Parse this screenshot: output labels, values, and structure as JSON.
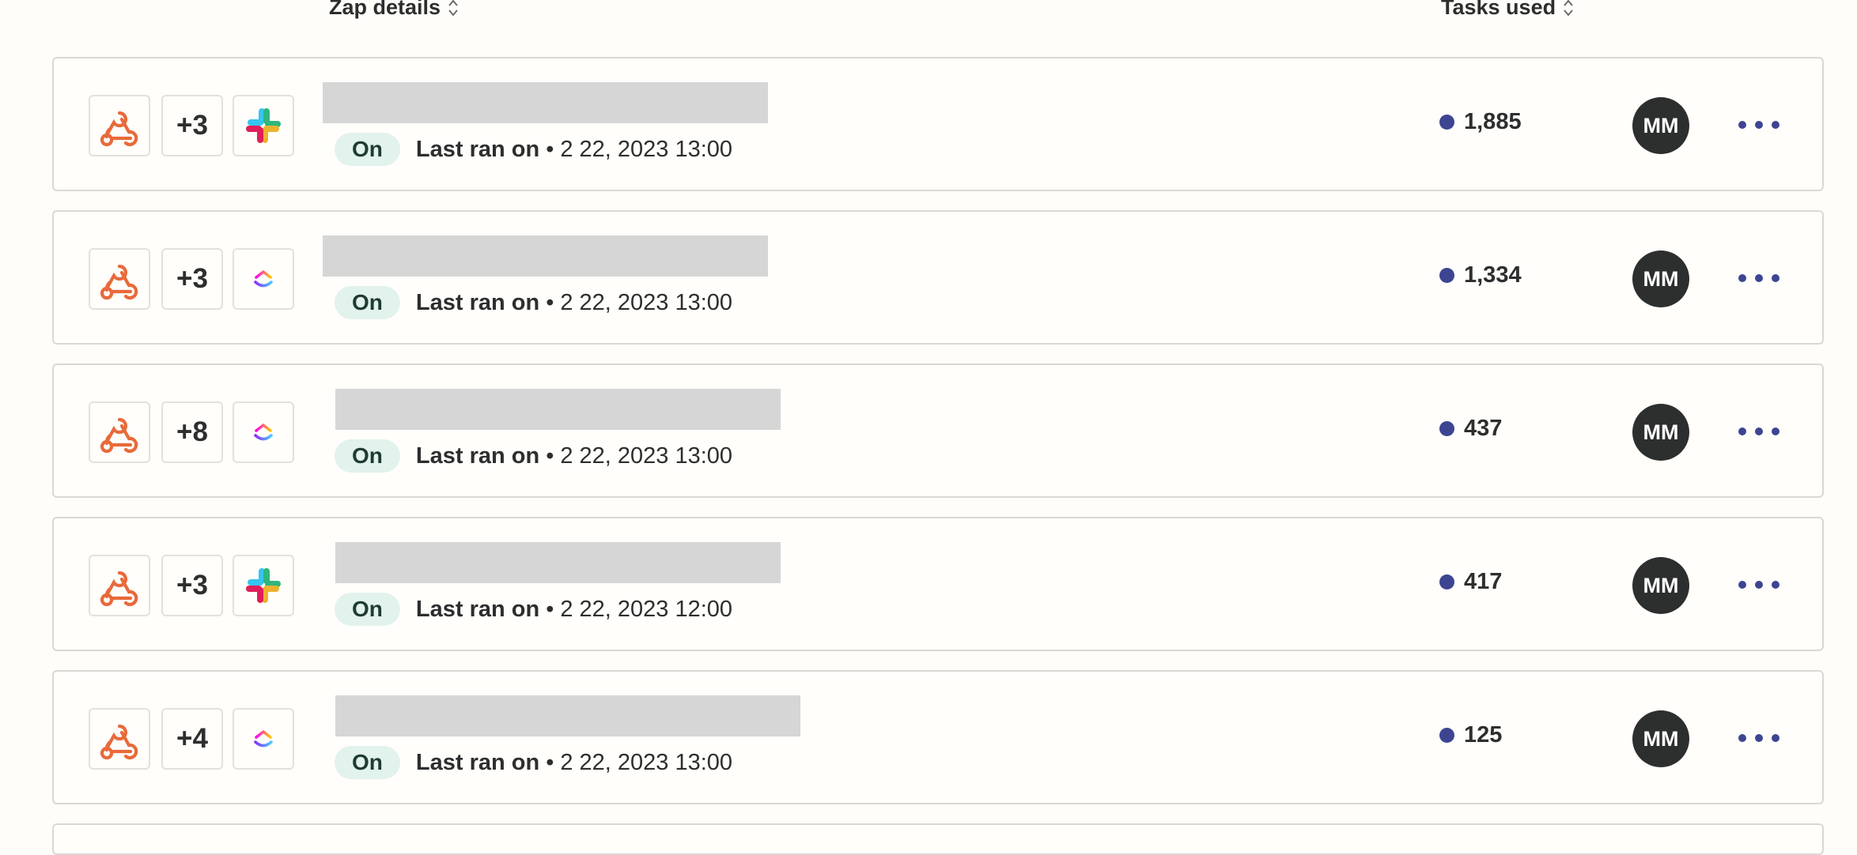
{
  "header": {
    "zap_details_label": "Zap details",
    "tasks_used_label": "Tasks used"
  },
  "colors": {
    "webhook_orange": "#e86a3a",
    "status_on_bg": "#e2f2ec",
    "task_dot": "#3d4592",
    "avatar_bg": "#2d2e2e",
    "more_dots": "#3d4592",
    "redacted_bar": "#d6d6d6"
  },
  "rows": [
    {
      "trigger_icon": "webhook-icon",
      "extra_apps": "+3",
      "last_app_icon": "slack-icon",
      "status": "On",
      "last_ran_label": "Last ran on",
      "bullet": "•",
      "last_ran_time": "2 22, 2023 13:00",
      "tasks": "1,885",
      "owner_initials": "MM"
    },
    {
      "trigger_icon": "webhook-icon",
      "extra_apps": "+3",
      "last_app_icon": "clickup-icon",
      "status": "On",
      "last_ran_label": "Last ran on",
      "bullet": "•",
      "last_ran_time": "2 22, 2023 13:00",
      "tasks": "1,334",
      "owner_initials": "MM"
    },
    {
      "trigger_icon": "webhook-icon",
      "extra_apps": "+8",
      "last_app_icon": "clickup-icon",
      "status": "On",
      "last_ran_label": "Last ran on",
      "bullet": "•",
      "last_ran_time": "2 22, 2023 13:00",
      "tasks": "437",
      "owner_initials": "MM"
    },
    {
      "trigger_icon": "webhook-icon",
      "extra_apps": "+3",
      "last_app_icon": "slack-icon",
      "status": "On",
      "last_ran_label": "Last ran on",
      "bullet": "•",
      "last_ran_time": "2 22, 2023 12:00",
      "tasks": "417",
      "owner_initials": "MM"
    },
    {
      "trigger_icon": "webhook-icon",
      "extra_apps": "+4",
      "last_app_icon": "clickup-icon",
      "status": "On",
      "last_ran_label": "Last ran on",
      "bullet": "•",
      "last_ran_time": "2 22, 2023 13:00",
      "tasks": "125",
      "owner_initials": "MM"
    }
  ]
}
